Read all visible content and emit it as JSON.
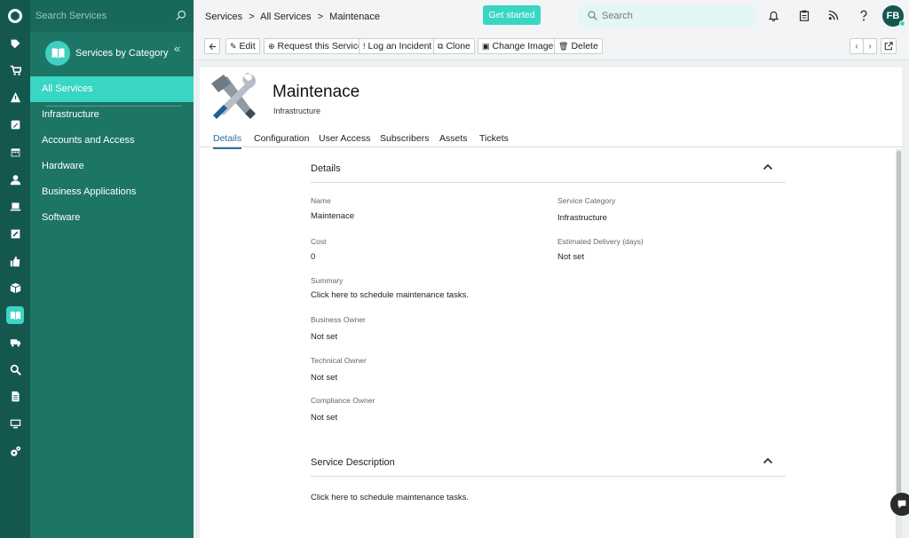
{
  "sidebar": {
    "search_placeholder": "Search Services",
    "header_title": "Services by Category",
    "items": [
      {
        "label": "All Services"
      },
      {
        "label": "Infrastructure"
      },
      {
        "label": "Accounts and Access"
      },
      {
        "label": "Hardware"
      },
      {
        "label": "Business Applications"
      },
      {
        "label": "Software"
      }
    ]
  },
  "breadcrumb": [
    "Services",
    ">",
    "All Services",
    ">",
    "Maintenace"
  ],
  "topbar": {
    "get_started": "Get started",
    "search_placeholder": "Search",
    "avatar_initials": "FB"
  },
  "toolbar": {
    "edit": "Edit",
    "request": "Request this Service",
    "incident": "Log an Incident",
    "clone": "Clone",
    "change_image": "Change Image",
    "delete": "Delete"
  },
  "service": {
    "title": "Maintenace",
    "category_subtitle": "Infrastructure"
  },
  "tabs": [
    {
      "label": "Details"
    },
    {
      "label": "Configuration"
    },
    {
      "label": "User Access"
    },
    {
      "label": "Subscribers"
    },
    {
      "label": "Assets"
    },
    {
      "label": "Tickets"
    }
  ],
  "details": {
    "section_title": "Details",
    "fields": {
      "name_label": "Name",
      "name_value": "Maintenace",
      "category_label": "Service Category",
      "category_value": "Infrastructure",
      "cost_label": "Cost",
      "cost_value": "0",
      "delivery_label": "Estimated Delivery (days)",
      "delivery_value": "Not set",
      "summary_label": "Summary",
      "summary_value": "Click here to schedule maintenance tasks.",
      "business_owner_label": "Business Owner",
      "business_owner_value": "Not set",
      "technical_owner_label": "Technical Owner",
      "technical_owner_value": "Not set",
      "compliance_owner_label": "Compliance Owner",
      "compliance_owner_value": "Not set"
    }
  },
  "description": {
    "section_title": "Service Description",
    "text": "Click here to schedule maintenance tasks."
  },
  "colors": {
    "rail": "#14574f",
    "sidebar": "#1d7566",
    "accent": "#3ad6c4",
    "active_tab": "#2a6fa1"
  }
}
